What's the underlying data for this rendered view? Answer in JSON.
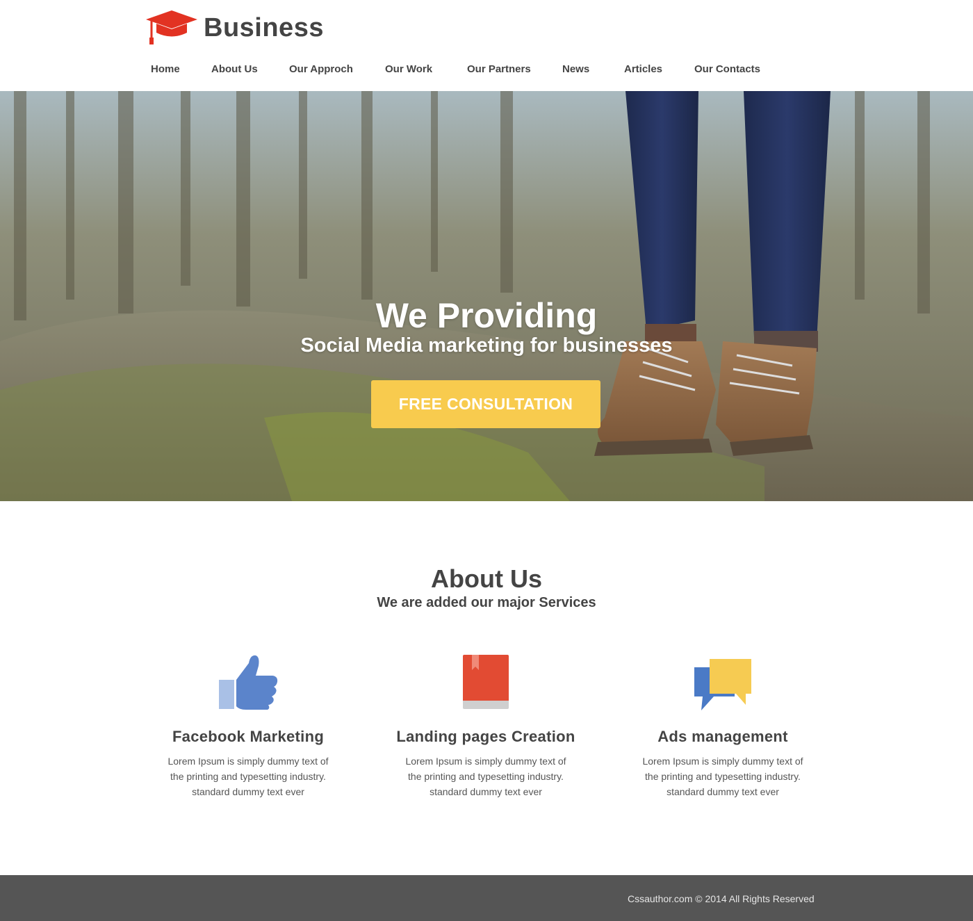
{
  "header": {
    "brand": "Business",
    "logo_icon": "graduation-cap-icon",
    "logo_color": "#e23222"
  },
  "nav": {
    "items": [
      {
        "label": "Home"
      },
      {
        "label": "About Us"
      },
      {
        "label": "Our Approch"
      },
      {
        "label": "Our Work"
      },
      {
        "label": "Our Partners"
      },
      {
        "label": "News"
      },
      {
        "label": "Articles"
      },
      {
        "label": "Our Contacts"
      }
    ]
  },
  "hero": {
    "title": "We Providing",
    "subtitle": "Social Media marketing for businesses",
    "cta_label": "FREE CONSULTATION",
    "cta_color": "#f8cb4e"
  },
  "about": {
    "title": "About Us",
    "subtitle": "We are added our major Services"
  },
  "services": [
    {
      "icon": "thumbs-up-icon",
      "title": "Facebook Marketing",
      "desc": "Lorem Ipsum is simply dummy text of the printing and typesetting industry. standard dummy text ever"
    },
    {
      "icon": "book-icon",
      "title": "Landing pages Creation",
      "desc": "Lorem Ipsum is simply dummy text of the printing and typesetting industry. standard dummy text ever"
    },
    {
      "icon": "chat-bubbles-icon",
      "title": "Ads management",
      "desc": "Lorem Ipsum is simply dummy text of the printing and typesetting industry. standard dummy text ever"
    }
  ],
  "footer": {
    "copyright": "Cssauthor.com © 2014 All Rights Reserved",
    "background": "#555555"
  }
}
